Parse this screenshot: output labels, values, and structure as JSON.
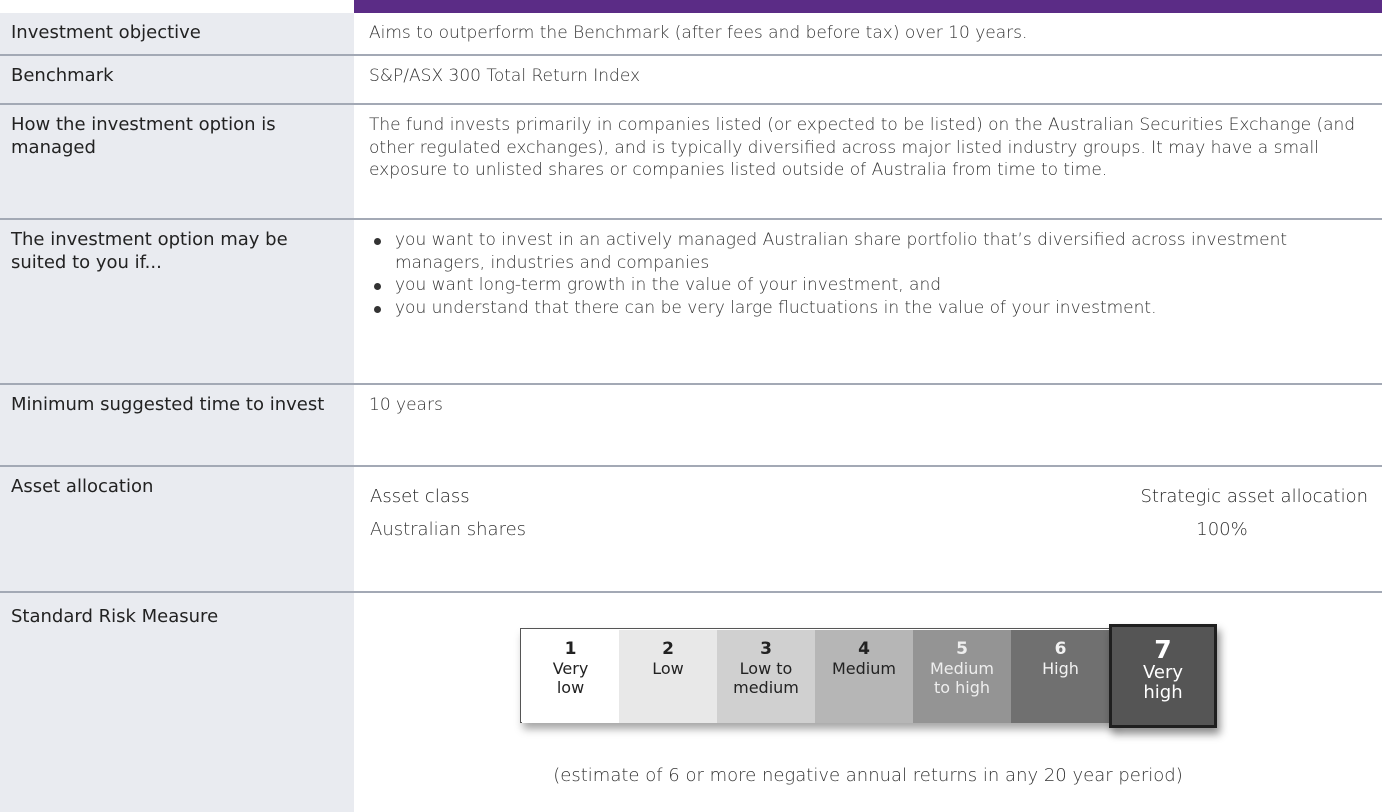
{
  "rows": {
    "objective": {
      "label": "Investment objective",
      "value": "Aims to outperform the Benchmark (after fees and before tax) over 10 years."
    },
    "benchmark": {
      "label": "Benchmark",
      "value": "S&P/ASX 300 Total Return Index"
    },
    "managed": {
      "label": "How the investment option is managed",
      "value": "The fund invests primarily in companies listed (or expected to be listed) on the Australian Securities Exchange (and other regulated exchanges), and is typically diversified across major listed industry groups. It may have a small exposure to unlisted shares or companies listed outside of Australia from time to time."
    },
    "suited": {
      "label": "The investment option may be suited to you if...",
      "bullets": [
        "you want to invest in an actively managed Australian share portfolio that’s diversified across investment managers, industries and companies",
        "you want long-term growth in the value of your investment, and",
        "you understand that there can be very large fluctuations in the value of your investment."
      ]
    },
    "min_time": {
      "label": "Minimum suggested time to invest",
      "value": "10 years"
    },
    "allocation": {
      "label": "Asset allocation",
      "col_asset": "Asset class",
      "col_saa": "Strategic asset allocation",
      "items": [
        {
          "asset": "Australian shares",
          "pct": "100%"
        }
      ]
    },
    "risk": {
      "label": "Standard Risk Measure",
      "levels": [
        {
          "num": "1",
          "line1": "Very",
          "line2": "low",
          "bg": "#ffffff",
          "color": "#222222"
        },
        {
          "num": "2",
          "line1": "Low",
          "line2": "",
          "bg": "#e8e8e8",
          "color": "#222222"
        },
        {
          "num": "3",
          "line1": "Low to",
          "line2": "medium",
          "bg": "#d0d0d0",
          "color": "#222222"
        },
        {
          "num": "4",
          "line1": "Medium",
          "line2": "",
          "bg": "#b6b6b6",
          "color": "#222222"
        },
        {
          "num": "5",
          "line1": "Medium",
          "line2": "to high",
          "bg": "#949494",
          "color": "#eeeeee"
        },
        {
          "num": "6",
          "line1": "High",
          "line2": "",
          "bg": "#707070",
          "color": "#f2f2f2"
        },
        {
          "num": "7",
          "line1": "Very",
          "line2": "high",
          "bg": "#555555",
          "color": "#ffffff"
        }
      ],
      "selected_level": 7,
      "note": "(estimate of 6 or more negative annual returns in any 20 year period)"
    }
  }
}
